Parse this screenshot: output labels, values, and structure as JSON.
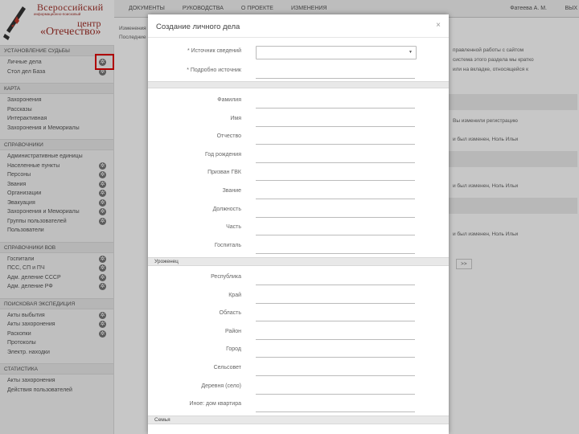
{
  "logo": {
    "line1": "Всероссийский",
    "line2": "информационно-поисковый",
    "line3": "центр",
    "line4": "«Отечество»"
  },
  "nav": [
    "ДОКУМЕНТЫ",
    "РУКОВОДСТВА",
    "О ПРОЕКТЕ",
    "ИЗМЕНЕНИЯ"
  ],
  "user": {
    "name": "Фатеева А. М.",
    "extra": "ВЫХ"
  },
  "sidebar": {
    "sections": [
      {
        "title": "УСТАНОВЛЕНИЕ СУДЬБЫ",
        "items": [
          {
            "label": "Личные дела",
            "gear": true
          },
          {
            "label": "Стол дел База",
            "gear": true
          }
        ]
      },
      {
        "title": "КАРТА",
        "items": [
          {
            "label": "Захоронения",
            "gear": false
          },
          {
            "label": "Рассказы",
            "gear": false
          },
          {
            "label": "Интерактивная",
            "gear": false
          },
          {
            "label": "Захоронения и Мемориалы",
            "gear": false
          }
        ]
      },
      {
        "title": "СПРАВОЧНИКИ",
        "items": [
          {
            "label": "Административные единицы",
            "gear": false
          },
          {
            "label": "Населенные пункты",
            "gear": true
          },
          {
            "label": "Персоны",
            "gear": true
          },
          {
            "label": "Звания",
            "gear": true
          },
          {
            "label": "Организации",
            "gear": true
          },
          {
            "label": "Эвакуация",
            "gear": true
          },
          {
            "label": "Захоронения и Мемориалы",
            "gear": true
          },
          {
            "label": "Группы пользователей",
            "gear": true
          },
          {
            "label": "Пользователи",
            "gear": false
          }
        ]
      },
      {
        "title": "СПРАВОЧНИКИ ВОВ",
        "items": [
          {
            "label": "Госпитали",
            "gear": true
          },
          {
            "label": "ПСС, СП и ПЧ",
            "gear": true
          },
          {
            "label": "Адм. деление СССР",
            "gear": true
          },
          {
            "label": "Адм. деление РФ",
            "gear": true
          }
        ]
      },
      {
        "title": "ПОИСКОВАЯ ЭКСПЕДИЦИЯ",
        "items": [
          {
            "label": "Акты выбытия",
            "gear": true
          },
          {
            "label": "Акты захоронения",
            "gear": true
          },
          {
            "label": "Раскопки",
            "gear": true
          },
          {
            "label": "Протоколы",
            "gear": false
          },
          {
            "label": "Электр. находки",
            "gear": false
          }
        ]
      },
      {
        "title": "СТАТИСТИКА",
        "items": [
          {
            "label": "Акты захоронения",
            "gear": false
          },
          {
            "label": "Действия пользователей",
            "gear": false
          }
        ]
      }
    ]
  },
  "background": {
    "breadcrumb1": "Изменения",
    "breadcrumb2": "Последние",
    "text1": "правленной работы с сайтом",
    "text2": "система этого раздела мы кратко",
    "text3": "или на вкладке, относящейся к",
    "row_text": "Вы изменили регистрацию",
    "row_text2": "и был изменен, Ноль Ильи",
    "pager": ">>"
  },
  "modal": {
    "title": "Создание личного дела",
    "close": "×",
    "top_fields": [
      {
        "label": "* Источник сведений",
        "type": "select",
        "value": ""
      },
      {
        "label": "* Подробно источник",
        "type": "text",
        "value": ""
      }
    ],
    "person_fields": [
      {
        "label": "Фамилия"
      },
      {
        "label": "Имя"
      },
      {
        "label": "Отчество"
      },
      {
        "label": "Год рождения"
      },
      {
        "label": "Призван ГВК"
      },
      {
        "label": "Звание"
      },
      {
        "label": "Должность"
      },
      {
        "label": "Часть"
      },
      {
        "label": "Госпиталь"
      }
    ],
    "section_birth": "Уроженец",
    "birth_fields": [
      {
        "label": "Республика"
      },
      {
        "label": "Край"
      },
      {
        "label": "Область"
      },
      {
        "label": "Район"
      },
      {
        "label": "Город"
      },
      {
        "label": "Сельсовет"
      },
      {
        "label": "Деревня (село)"
      },
      {
        "label": "Иное: дом квартира"
      }
    ],
    "section_family": "Семья"
  }
}
